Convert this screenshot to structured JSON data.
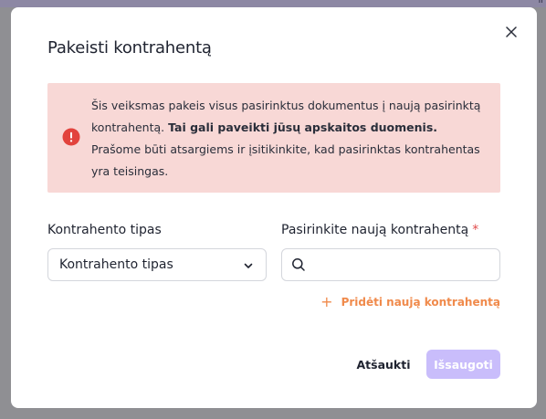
{
  "background": {
    "corner_text": "Ir",
    "overlay_color": "#8f8f93"
  },
  "modal": {
    "title": "Pakeisti kontrahentą",
    "close_icon": "close-icon",
    "alert": {
      "icon": "exclamation-circle-icon",
      "color": "#e2433d",
      "text_before": "Šis veiksmas pakeis visus pasirinktus dokumentus į naują pasirinktą kontrahentą. ",
      "text_bold": "Tai gali paveikti jūsų apskaitos duomenis.",
      "text_after": " Prašome būti atsargiems ir įsitikinkite, kad pasirinktas kontrahentas yra teisingas."
    },
    "type_field": {
      "label": "Kontrahento tipas",
      "selected_value": "Kontrahento tipas",
      "icon": "chevron-down-icon"
    },
    "counterparty_field": {
      "label": "Pasirinkite naują kontrahentą",
      "required_mark": "*",
      "value": "",
      "placeholder": "",
      "icon": "search-icon"
    },
    "add_link": {
      "icon": "plus-icon",
      "label": "Pridėti naują kontrahentą",
      "color": "#f08a4b"
    },
    "buttons": {
      "cancel_label": "Atšaukti",
      "save_label": "Išsaugoti",
      "save_color": "#c9bdfb"
    }
  }
}
